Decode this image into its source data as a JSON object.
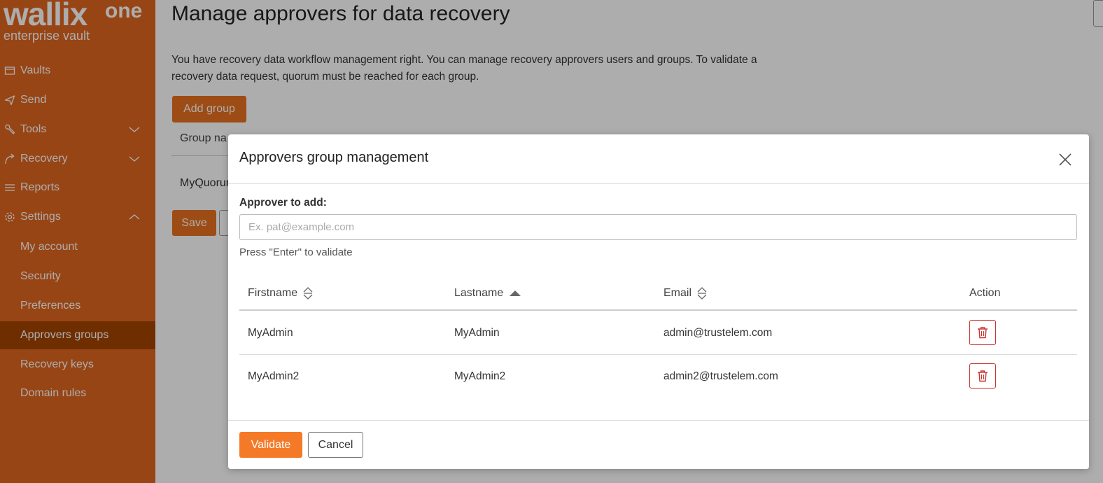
{
  "brand": {
    "logo_word": "wallix",
    "logo_suffix": "one",
    "tagline": "enterprise vault"
  },
  "sidebar": {
    "items": [
      {
        "label": "Vaults",
        "icon": "vault-icon"
      },
      {
        "label": "Send",
        "icon": "send-icon"
      },
      {
        "label": "Tools",
        "icon": "tools-icon"
      },
      {
        "label": "Recovery",
        "icon": "recovery-icon"
      },
      {
        "label": "Reports",
        "icon": "reports-icon"
      },
      {
        "label": "Settings",
        "icon": "gear-icon"
      }
    ],
    "settings_sub": [
      {
        "label": "My account"
      },
      {
        "label": "Security"
      },
      {
        "label": "Preferences"
      },
      {
        "label": "Approvers groups",
        "active": true
      },
      {
        "label": "Recovery keys"
      },
      {
        "label": "Domain rules"
      }
    ]
  },
  "page": {
    "title": "Manage approvers for data recovery",
    "description": "You have recovery data workflow management right. You can manage recovery approvers users and groups. To validate a recovery data request, quorum must be reached for each group.",
    "add_group_label": "Add group",
    "table_header_partial": "Group na",
    "row_partial": "MyQuorur",
    "save_label": "Save"
  },
  "modal": {
    "title": "Approvers group management",
    "field_label": "Approver to add:",
    "input_placeholder": "Ex. pat@example.com",
    "input_value": "",
    "hint": "Press \"Enter\" to validate",
    "columns": {
      "firstname": "Firstname",
      "lastname": "Lastname",
      "email": "Email",
      "action": "Action"
    },
    "rows": [
      {
        "firstname": "MyAdmin",
        "lastname": "MyAdmin",
        "email": "admin@trustelem.com"
      },
      {
        "firstname": "MyAdmin2",
        "lastname": "MyAdmin2",
        "email": "admin2@trustelem.com"
      }
    ],
    "validate_label": "Validate",
    "cancel_label": "Cancel"
  },
  "colors": {
    "sidebar_bg": "#e06620",
    "sidebar_active": "#a44500",
    "accent": "#f47a28",
    "danger": "#c8302c"
  }
}
